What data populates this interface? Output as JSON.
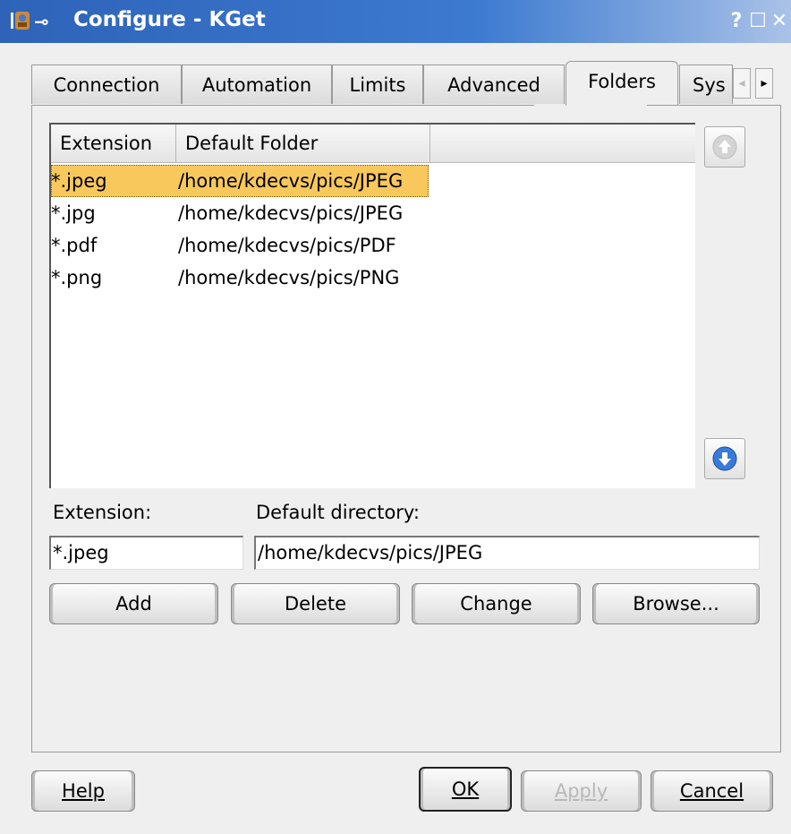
{
  "window": {
    "title": "Configure - KGet",
    "title_buttons": [
      "?",
      "☐",
      "✕"
    ],
    "accent": "#2e63b8"
  },
  "tabs": [
    {
      "label": "Connection",
      "active": false
    },
    {
      "label": "Automation",
      "active": false
    },
    {
      "label": "Limits",
      "active": false
    },
    {
      "label": "Advanced",
      "active": false
    },
    {
      "label": "Folders",
      "active": true
    },
    {
      "label": "Sys",
      "active": false
    }
  ],
  "tab_scroll": {
    "left_icon": "◂",
    "right_icon": "▸"
  },
  "folders_list": {
    "columns": [
      "Extension",
      "Default Folder"
    ],
    "rows": [
      {
        "extension": "*.jpeg",
        "folder": "/home/kdecvs/pics/JPEG",
        "selected": true
      },
      {
        "extension": "*.jpg",
        "folder": "/home/kdecvs/pics/JPEG",
        "selected": false
      },
      {
        "extension": "*.pdf",
        "folder": "/home/kdecvs/pics/PDF",
        "selected": false
      },
      {
        "extension": "*.png",
        "folder": "/home/kdecvs/pics/PNG",
        "selected": false
      }
    ],
    "selection_color": "#f8c85c"
  },
  "move_buttons": {
    "up_icon": "arrow-up-icon",
    "down_icon": "arrow-down-icon"
  },
  "form": {
    "extension_label": "Extension:",
    "directory_label": "Default directory:",
    "extension_value": "*.jpeg",
    "directory_value": "/home/kdecvs/pics/JPEG"
  },
  "actions": {
    "add": "Add",
    "delete": "Delete",
    "change": "Change",
    "browse": "Browse..."
  },
  "dialog_buttons": {
    "help": "Help",
    "ok": "OK",
    "apply": "Apply",
    "cancel": "Cancel"
  }
}
